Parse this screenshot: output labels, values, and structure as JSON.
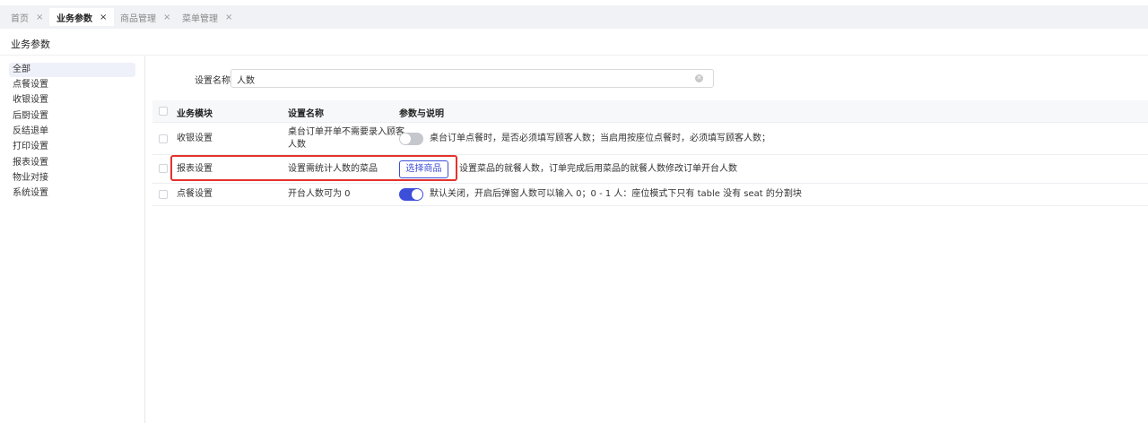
{
  "tabs": [
    {
      "label": "首页",
      "close": "×"
    },
    {
      "label": "业务参数",
      "close": "×"
    },
    {
      "label": "商品管理",
      "close": "×"
    },
    {
      "label": "菜单管理",
      "close": "×"
    }
  ],
  "page_title": "业务参数",
  "sidebar": {
    "items": [
      "全部",
      "点餐设置",
      "收银设置",
      "后厨设置",
      "反结退单",
      "打印设置",
      "报表设置",
      "物业对接",
      "系统设置"
    ],
    "active": "全部"
  },
  "search": {
    "label": "设置名称",
    "value": "人数"
  },
  "table": {
    "headers": [
      "业务模块",
      "设置名称",
      "参数与说明"
    ],
    "rows": [
      {
        "module": "收银设置",
        "name_line1": "桌台订单开单不需要录入顾客",
        "name_line2": "人数",
        "control": "toggle-off",
        "description": "桌台订单点餐时，是否必须填写顾客人数；当启用按座位点餐时，必须填写顾客人数；"
      },
      {
        "module": "报表设置",
        "name_line1": "设置需统计人数的菜品",
        "control": "button",
        "button_label": "选择商品",
        "description": "设置菜品的就餐人数，订单完成后用菜品的就餐人数修改订单开台人数"
      },
      {
        "module": "点餐设置",
        "name_line1": "开台人数可为 0",
        "control": "toggle-on",
        "description": "默认关闭，开启后弹窗人数可以输入 0；0 - 1 人：座位模式下只有 table 没有 seat 的分割块"
      }
    ]
  },
  "colors": {
    "accent": "#3d4ed8",
    "highlight": "#e5322d",
    "toggle_off": "#c4c7cc"
  }
}
